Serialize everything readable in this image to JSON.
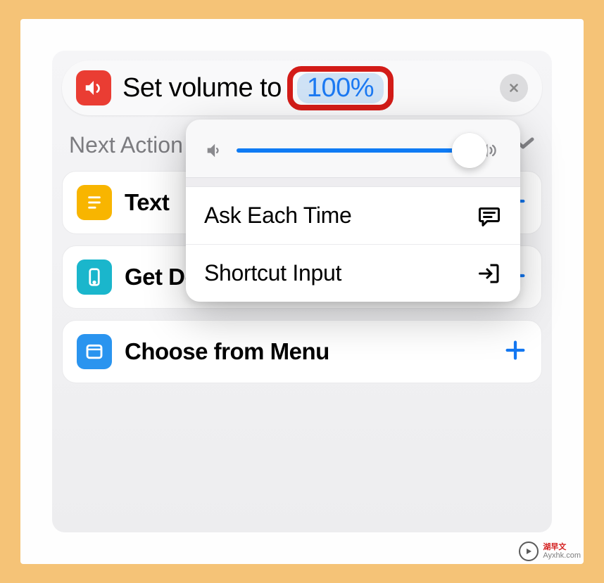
{
  "action": {
    "label": "Set volume to",
    "value": "100%"
  },
  "section_title": "Next Action Suggestions",
  "suggestions": [
    {
      "title": "Text"
    },
    {
      "title": "Get Device Details"
    },
    {
      "title": "Choose from Menu"
    }
  ],
  "popover": {
    "slider_percent": 100,
    "menu": [
      {
        "label": "Ask Each Time"
      },
      {
        "label": "Shortcut Input"
      }
    ]
  },
  "watermark": {
    "brand": "湖早文",
    "url": "Ayxhk.com"
  }
}
